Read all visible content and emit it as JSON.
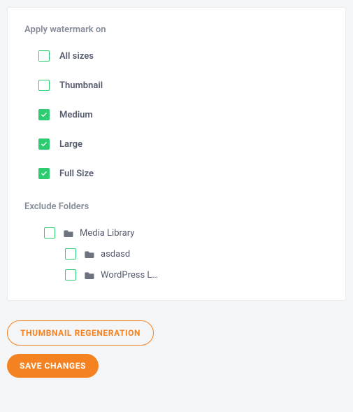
{
  "colors": {
    "accent_green": "#2ecc71",
    "accent_orange": "#f58220"
  },
  "watermark": {
    "title": "Apply watermark on",
    "options": [
      {
        "label": "All sizes",
        "checked": false
      },
      {
        "label": "Thumbnail",
        "checked": false
      },
      {
        "label": "Medium",
        "checked": true
      },
      {
        "label": "Large",
        "checked": true
      },
      {
        "label": "Full Size",
        "checked": true
      }
    ]
  },
  "exclude": {
    "title": "Exclude Folders",
    "tree": {
      "label": "Media Library",
      "checked": false,
      "children": [
        {
          "label": "asdasd",
          "checked": false
        },
        {
          "label": "WordPress L…",
          "checked": false
        }
      ]
    }
  },
  "actions": {
    "thumbnail_regeneration": "THUMBNAIL REGENERATION",
    "save_changes": "SAVE CHANGES"
  }
}
